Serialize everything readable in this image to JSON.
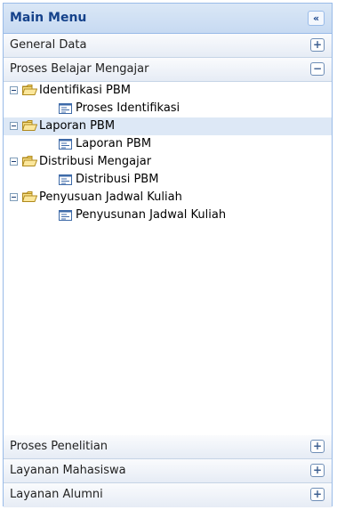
{
  "menu": {
    "title": "Main Menu",
    "collapse_glyph": "«",
    "sections_top": [
      {
        "label": "General Data",
        "toggle": "+",
        "expanded": false
      },
      {
        "label": "Proses Belajar Mengajar",
        "toggle": "−",
        "expanded": true
      }
    ],
    "tree": [
      {
        "label": "Identifikasi PBM",
        "type": "folder",
        "icon": "folder-open-icon",
        "expanded": true,
        "children": [
          {
            "label": "Proses Identifikasi",
            "type": "leaf",
            "icon": "list-icon"
          }
        ]
      },
      {
        "label": "Laporan PBM",
        "type": "folder",
        "icon": "folder-open-icon",
        "expanded": true,
        "selected": true,
        "children": [
          {
            "label": "Laporan PBM",
            "type": "leaf",
            "icon": "list-icon"
          }
        ]
      },
      {
        "label": "Distribusi Mengajar",
        "type": "folder",
        "icon": "folder-open-icon",
        "expanded": true,
        "children": [
          {
            "label": "Distribusi PBM",
            "type": "leaf",
            "icon": "list-icon"
          }
        ]
      },
      {
        "label": "Penyusuan Jadwal Kuliah",
        "type": "folder",
        "icon": "folder-open-icon",
        "expanded": true,
        "children": [
          {
            "label": "Penyusunan Jadwal Kuliah",
            "type": "leaf",
            "icon": "list-icon"
          }
        ]
      }
    ],
    "sections_bottom": [
      {
        "label": "Proses Penelitian",
        "toggle": "+",
        "expanded": false
      },
      {
        "label": "Layanan Mahasiswa",
        "toggle": "+",
        "expanded": false
      },
      {
        "label": "Layanan Alumni",
        "toggle": "+",
        "expanded": false
      }
    ]
  },
  "colors": {
    "header_text": "#15428b",
    "border": "#99bbe8",
    "folder": "#f5d76e",
    "selected_row": "#dde8f6"
  }
}
